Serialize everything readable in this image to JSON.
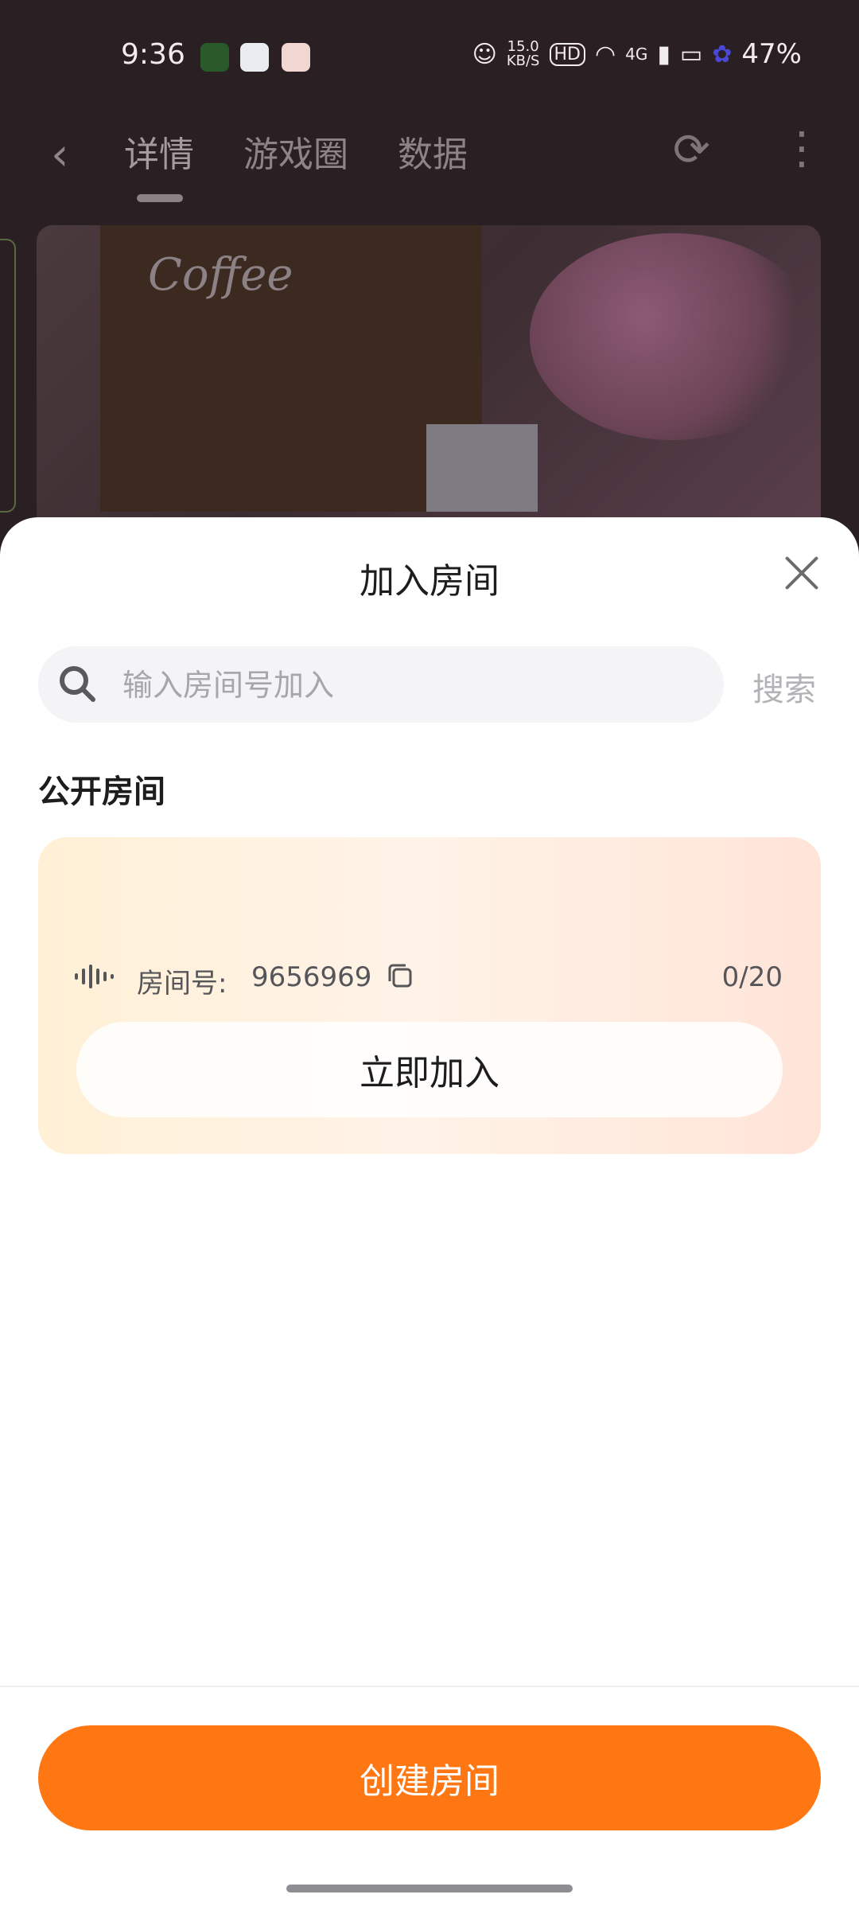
{
  "status_bar": {
    "time": "9:36",
    "network_speed_value": "15.0",
    "network_speed_unit": "KB/S",
    "hd_badge": "HD",
    "cellular": "4G",
    "battery": "47%"
  },
  "nav": {
    "tabs": [
      {
        "label": "详情"
      },
      {
        "label": "游戏圈"
      },
      {
        "label": "数据"
      }
    ],
    "active_tab": "详情"
  },
  "media": {
    "sign_text": "Coffee"
  },
  "sheet": {
    "title": "加入房间",
    "search": {
      "placeholder": "输入房间号加入",
      "value": "",
      "button_label": "搜索"
    },
    "section_title": "公开房间",
    "rooms": [
      {
        "label": "房间号:",
        "id": "9656969",
        "count": "0/20",
        "join_label": "立即加入"
      }
    ],
    "create_label": "创建房间"
  },
  "colors": {
    "accent": "#ff7713",
    "card_gradient_start": "#fff0d6",
    "card_gradient_end": "#ffe4d8",
    "dim_background": "#2a1f22"
  }
}
